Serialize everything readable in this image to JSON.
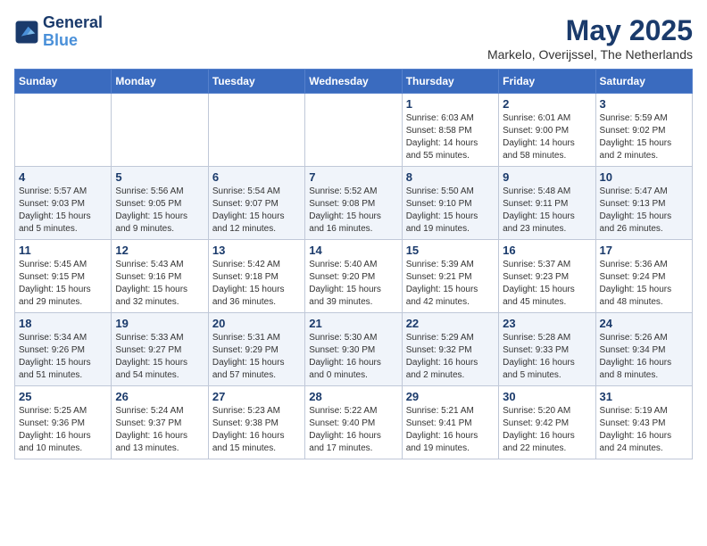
{
  "header": {
    "logo_line1": "General",
    "logo_line2": "Blue",
    "month": "May 2025",
    "location": "Markelo, Overijssel, The Netherlands"
  },
  "days_of_week": [
    "Sunday",
    "Monday",
    "Tuesday",
    "Wednesday",
    "Thursday",
    "Friday",
    "Saturday"
  ],
  "weeks": [
    [
      {
        "day": "",
        "info": ""
      },
      {
        "day": "",
        "info": ""
      },
      {
        "day": "",
        "info": ""
      },
      {
        "day": "",
        "info": ""
      },
      {
        "day": "1",
        "info": "Sunrise: 6:03 AM\nSunset: 8:58 PM\nDaylight: 14 hours\nand 55 minutes."
      },
      {
        "day": "2",
        "info": "Sunrise: 6:01 AM\nSunset: 9:00 PM\nDaylight: 14 hours\nand 58 minutes."
      },
      {
        "day": "3",
        "info": "Sunrise: 5:59 AM\nSunset: 9:02 PM\nDaylight: 15 hours\nand 2 minutes."
      }
    ],
    [
      {
        "day": "4",
        "info": "Sunrise: 5:57 AM\nSunset: 9:03 PM\nDaylight: 15 hours\nand 5 minutes."
      },
      {
        "day": "5",
        "info": "Sunrise: 5:56 AM\nSunset: 9:05 PM\nDaylight: 15 hours\nand 9 minutes."
      },
      {
        "day": "6",
        "info": "Sunrise: 5:54 AM\nSunset: 9:07 PM\nDaylight: 15 hours\nand 12 minutes."
      },
      {
        "day": "7",
        "info": "Sunrise: 5:52 AM\nSunset: 9:08 PM\nDaylight: 15 hours\nand 16 minutes."
      },
      {
        "day": "8",
        "info": "Sunrise: 5:50 AM\nSunset: 9:10 PM\nDaylight: 15 hours\nand 19 minutes."
      },
      {
        "day": "9",
        "info": "Sunrise: 5:48 AM\nSunset: 9:11 PM\nDaylight: 15 hours\nand 23 minutes."
      },
      {
        "day": "10",
        "info": "Sunrise: 5:47 AM\nSunset: 9:13 PM\nDaylight: 15 hours\nand 26 minutes."
      }
    ],
    [
      {
        "day": "11",
        "info": "Sunrise: 5:45 AM\nSunset: 9:15 PM\nDaylight: 15 hours\nand 29 minutes."
      },
      {
        "day": "12",
        "info": "Sunrise: 5:43 AM\nSunset: 9:16 PM\nDaylight: 15 hours\nand 32 minutes."
      },
      {
        "day": "13",
        "info": "Sunrise: 5:42 AM\nSunset: 9:18 PM\nDaylight: 15 hours\nand 36 minutes."
      },
      {
        "day": "14",
        "info": "Sunrise: 5:40 AM\nSunset: 9:20 PM\nDaylight: 15 hours\nand 39 minutes."
      },
      {
        "day": "15",
        "info": "Sunrise: 5:39 AM\nSunset: 9:21 PM\nDaylight: 15 hours\nand 42 minutes."
      },
      {
        "day": "16",
        "info": "Sunrise: 5:37 AM\nSunset: 9:23 PM\nDaylight: 15 hours\nand 45 minutes."
      },
      {
        "day": "17",
        "info": "Sunrise: 5:36 AM\nSunset: 9:24 PM\nDaylight: 15 hours\nand 48 minutes."
      }
    ],
    [
      {
        "day": "18",
        "info": "Sunrise: 5:34 AM\nSunset: 9:26 PM\nDaylight: 15 hours\nand 51 minutes."
      },
      {
        "day": "19",
        "info": "Sunrise: 5:33 AM\nSunset: 9:27 PM\nDaylight: 15 hours\nand 54 minutes."
      },
      {
        "day": "20",
        "info": "Sunrise: 5:31 AM\nSunset: 9:29 PM\nDaylight: 15 hours\nand 57 minutes."
      },
      {
        "day": "21",
        "info": "Sunrise: 5:30 AM\nSunset: 9:30 PM\nDaylight: 16 hours\nand 0 minutes."
      },
      {
        "day": "22",
        "info": "Sunrise: 5:29 AM\nSunset: 9:32 PM\nDaylight: 16 hours\nand 2 minutes."
      },
      {
        "day": "23",
        "info": "Sunrise: 5:28 AM\nSunset: 9:33 PM\nDaylight: 16 hours\nand 5 minutes."
      },
      {
        "day": "24",
        "info": "Sunrise: 5:26 AM\nSunset: 9:34 PM\nDaylight: 16 hours\nand 8 minutes."
      }
    ],
    [
      {
        "day": "25",
        "info": "Sunrise: 5:25 AM\nSunset: 9:36 PM\nDaylight: 16 hours\nand 10 minutes."
      },
      {
        "day": "26",
        "info": "Sunrise: 5:24 AM\nSunset: 9:37 PM\nDaylight: 16 hours\nand 13 minutes."
      },
      {
        "day": "27",
        "info": "Sunrise: 5:23 AM\nSunset: 9:38 PM\nDaylight: 16 hours\nand 15 minutes."
      },
      {
        "day": "28",
        "info": "Sunrise: 5:22 AM\nSunset: 9:40 PM\nDaylight: 16 hours\nand 17 minutes."
      },
      {
        "day": "29",
        "info": "Sunrise: 5:21 AM\nSunset: 9:41 PM\nDaylight: 16 hours\nand 19 minutes."
      },
      {
        "day": "30",
        "info": "Sunrise: 5:20 AM\nSunset: 9:42 PM\nDaylight: 16 hours\nand 22 minutes."
      },
      {
        "day": "31",
        "info": "Sunrise: 5:19 AM\nSunset: 9:43 PM\nDaylight: 16 hours\nand 24 minutes."
      }
    ]
  ]
}
